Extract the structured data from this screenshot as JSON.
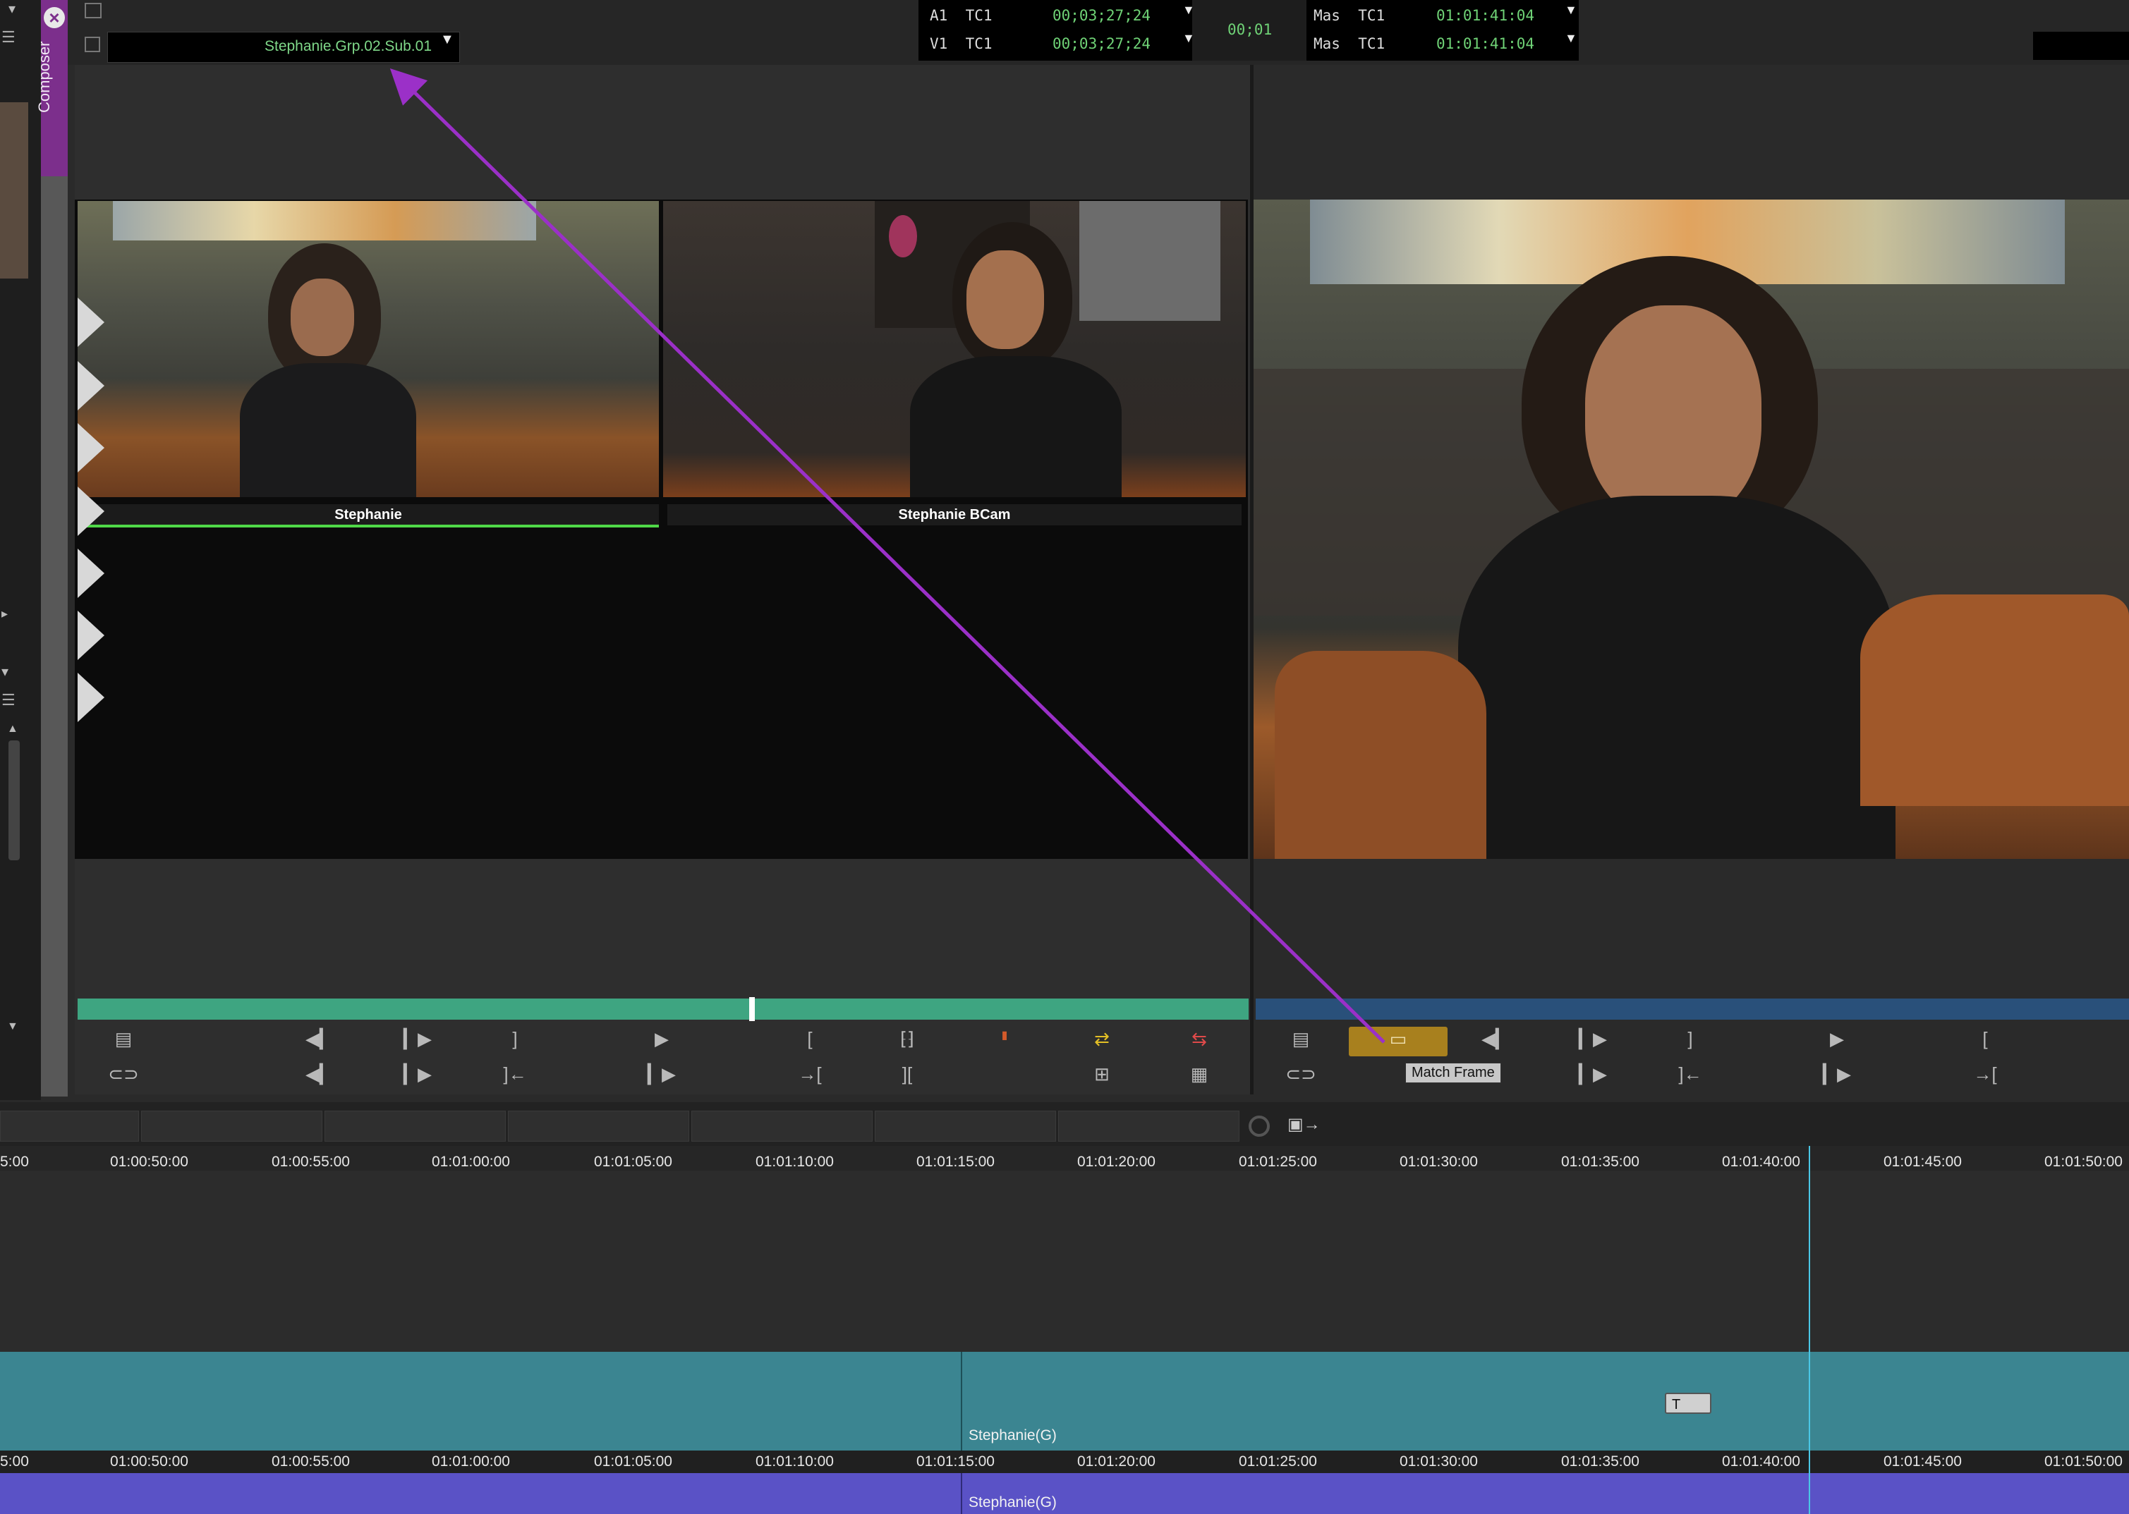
{
  "composer": {
    "tab_label": "Composer"
  },
  "source": {
    "clip_name": "Stephanie.Grp.02.Sub.01",
    "cameras": [
      {
        "label": "Stephanie"
      },
      {
        "label": "Stephanie BCam"
      }
    ]
  },
  "timecode": {
    "rows": [
      {
        "track": "A1",
        "type": "TC1",
        "value": "00;03;27;24"
      },
      {
        "track": "V1",
        "type": "TC1",
        "value": "00;03;27;24"
      }
    ],
    "duration": "00;01",
    "record_rows": [
      {
        "track": "Mas",
        "type": "TC1",
        "value": "01:01:41:04"
      },
      {
        "track": "Mas",
        "type": "TC1",
        "value": "01:01:41:04"
      }
    ]
  },
  "tooltip": "Match Frame",
  "timeline": {
    "ruler": [
      "5:00",
      "01:00:50:00",
      "01:00:55:00",
      "01:01:00:00",
      "01:01:05:00",
      "01:01:10:00",
      "01:01:15:00",
      "01:01:20:00",
      "01:01:25:00",
      "01:01:30:00",
      "01:01:35:00",
      "01:01:40:00",
      "01:01:45:00",
      "01:01:50:00"
    ],
    "video_clip": "Stephanie(G)",
    "audio_clip": "Stephanie(G)",
    "title_icon": "T"
  },
  "colors": {
    "accent": "#7c2f8c",
    "source_scrub": "#3ea581",
    "record_scrub": "#29507a",
    "video_track": "#3b8591",
    "audio_track": "#5a52c6",
    "playhead": "#4ac7e6",
    "timecode": "#6fd276"
  }
}
